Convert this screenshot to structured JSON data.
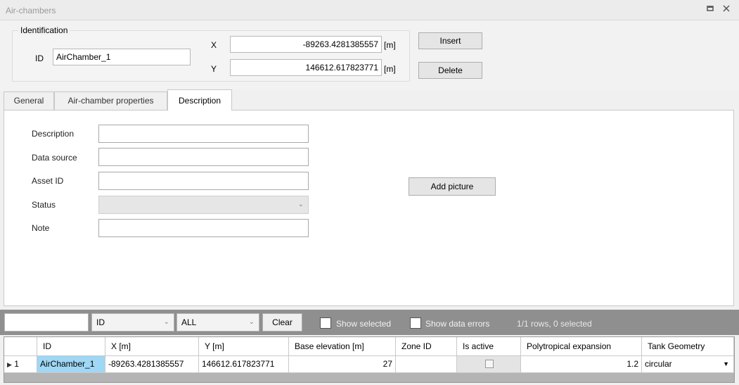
{
  "window": {
    "title": "Air-chambers",
    "maximize_icon": "maximize-icon",
    "close_icon": "close-icon"
  },
  "identification": {
    "group_label": "Identification",
    "id_label": "ID",
    "id_value": "AirChamber_1",
    "x_label": "X",
    "x_value": "-89263.4281385557",
    "x_unit": "[m]",
    "y_label": "Y",
    "y_value": "146612.617823771",
    "y_unit": "[m]",
    "insert_label": "Insert",
    "delete_label": "Delete"
  },
  "tabs": [
    {
      "label": "General",
      "active": false
    },
    {
      "label": "Air-chamber properties",
      "active": false
    },
    {
      "label": "Description",
      "active": true
    }
  ],
  "description_form": {
    "fields": [
      {
        "label": "Description",
        "value": ""
      },
      {
        "label": "Data source",
        "value": ""
      },
      {
        "label": "Asset ID",
        "value": ""
      },
      {
        "label": "Status",
        "value": ""
      },
      {
        "label": "Note",
        "value": ""
      }
    ],
    "add_picture_label": "Add picture"
  },
  "filter": {
    "search_value": "",
    "column_select": "ID",
    "scope_select": "ALL",
    "clear_label": "Clear",
    "show_selected_label": "Show selected",
    "show_data_errors_label": "Show data errors",
    "row_status": "1/1 rows, 0 selected"
  },
  "grid": {
    "columns": [
      "ID",
      "X [m]",
      "Y [m]",
      "Base elevation [m]",
      "Zone ID",
      "Is active",
      "Polytropical expansion",
      "Tank Geometry"
    ],
    "rows": [
      {
        "row_number": "1",
        "id": "AirChamber_1",
        "x": "-89263.4281385557",
        "y": "146612.617823771",
        "base_elevation": "27",
        "zone_id": "",
        "is_active": false,
        "polytropical_expansion": "1.2",
        "tank_geometry": "circular"
      }
    ]
  },
  "colors": {
    "selected_cell": "#9fd7f4",
    "filter_bar": "#8f8f8f",
    "panel_bg": "#f0f0f0"
  }
}
